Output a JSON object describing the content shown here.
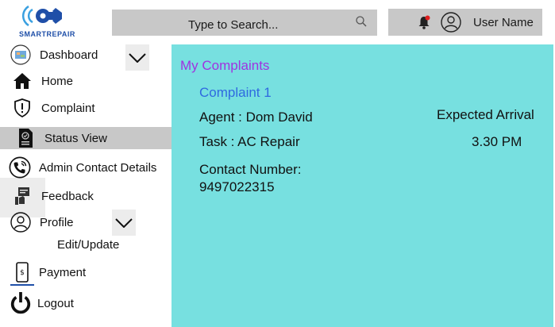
{
  "header": {
    "logo_text": "SMARTREPAIR",
    "search_placeholder": "Type to Search...",
    "user_name": "User Name",
    "icons": {
      "search": "search-icon",
      "bell": "bell-icon",
      "avatar": "user-avatar-icon"
    },
    "colors": {
      "bar_gray": "#c8c8c8",
      "brand_blue": "#1f4fa8",
      "notification_red": "#e02020"
    }
  },
  "sidebar": {
    "items": [
      {
        "label": "Dashboard",
        "icon": "dashboard-icon"
      },
      {
        "label": "Home",
        "icon": "home-icon"
      },
      {
        "label": "Complaint",
        "icon": "shield-alert-icon"
      },
      {
        "label": "Status View",
        "icon": "document-icon",
        "active": true
      },
      {
        "label": "Admin Contact Details",
        "icon": "phone-icon"
      },
      {
        "label": "Feedback",
        "icon": "feedback-icon"
      },
      {
        "label": "Profile",
        "icon": "profile-icon"
      },
      {
        "label": "Edit/Update",
        "icon": ""
      },
      {
        "label": "Payment",
        "icon": "payment-phone-icon"
      },
      {
        "label": "Logout",
        "icon": "power-icon"
      }
    ]
  },
  "main": {
    "title": "My Complaints",
    "complaint": {
      "heading": "Complaint 1",
      "agent": "Agent :  Dom David",
      "task": "Task : AC Repair",
      "contact_label": "Contact Number:",
      "contact_number": "9497022315",
      "arrival_label": "Expected Arrival",
      "arrival_time": "3.30 PM"
    },
    "colors": {
      "background": "#77e0e0",
      "title": "#a033e0",
      "heading": "#2f6ae0"
    }
  }
}
